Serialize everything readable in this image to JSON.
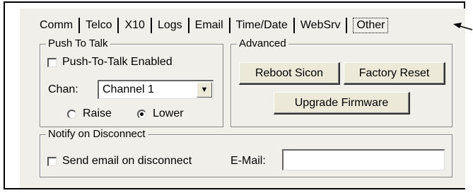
{
  "tabs": [
    {
      "label": "Comm"
    },
    {
      "label": "Telco"
    },
    {
      "label": "X10"
    },
    {
      "label": "Logs"
    },
    {
      "label": "Email"
    },
    {
      "label": "Time/Date"
    },
    {
      "label": "WebSrv"
    },
    {
      "label": "Other",
      "active": true
    }
  ],
  "push_to_talk": {
    "title": "Push To Talk",
    "enabled_label": "Push-To-Talk Enabled",
    "enabled_checked": false,
    "chan_label": "Chan:",
    "chan_value": "Channel 1",
    "raise_label": "Raise",
    "lower_label": "Lower",
    "selected": "Lower"
  },
  "advanced": {
    "title": "Advanced",
    "reboot_label": "Reboot Sicon",
    "factory_reset_label": "Factory Reset",
    "upgrade_label": "Upgrade Firmware"
  },
  "notify": {
    "title": "Notify on Disconnect",
    "send_email_label": "Send email on disconnect",
    "send_email_checked": false,
    "email_label": "E-Mail:",
    "email_value": ""
  },
  "icons": {
    "pointer": "arrow-pointer-icon",
    "dropdown": "chevron-down-icon"
  }
}
